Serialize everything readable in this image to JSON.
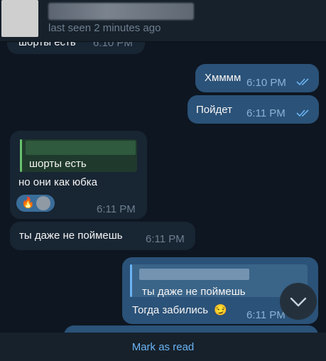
{
  "header": {
    "status": "last seen 2 minutes ago"
  },
  "messages": [
    {
      "dir": "in",
      "text": "шорты есть",
      "time": "6:10 PM"
    },
    {
      "dir": "out",
      "text": "Хмммм",
      "time": "6:10 PM"
    },
    {
      "dir": "out",
      "text": "Пойдет",
      "time": "6:11 PM"
    },
    {
      "dir": "in",
      "reply_quote": "шорты есть",
      "text": "но они как юбка",
      "reaction_emoji": "🔥",
      "time": "6:11 PM"
    },
    {
      "dir": "in",
      "text": "ты даже не поймешь",
      "time": "6:11 PM"
    },
    {
      "dir": "out",
      "reply_quote": "ты даже не поймешь",
      "text": "Тогда забились",
      "emoji": "😏",
      "time": "6:11 PM"
    }
  ],
  "footer": {
    "mark_as_read": "Mark as read"
  },
  "colors": {
    "background": "#0e1621",
    "incoming_bubble": "#182533",
    "outgoing_bubble": "#2b5278",
    "accent": "#6ab3f3"
  },
  "icons": {
    "read_ticks": "double-check-icon",
    "scroll_down": "chevron-down-icon"
  }
}
